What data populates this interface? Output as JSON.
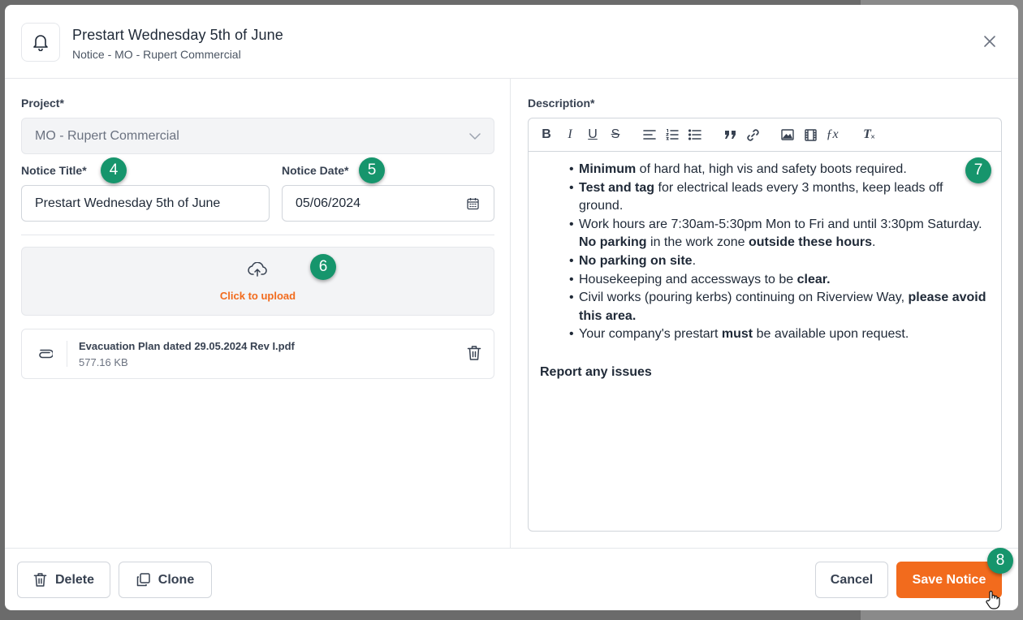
{
  "header": {
    "title": "Prestart Wednesday 5th of June",
    "subtitle": "Notice - MO - Rupert Commercial"
  },
  "form": {
    "project_label": "Project*",
    "project_value": "MO - Rupert Commercial",
    "title_label": "Notice Title*",
    "title_value": "Prestart Wednesday 5th of June",
    "date_label": "Notice Date*",
    "date_value": "05/06/2024",
    "upload_text": "Click to upload",
    "attachment": {
      "name": "Evacuation Plan dated 29.05.2024 Rev I.pdf",
      "size": "577.16 KB"
    }
  },
  "description": {
    "label": "Description*",
    "toolbar": [
      "bold",
      "italic",
      "underline",
      "strikethrough",
      "align-left",
      "ordered-list",
      "bullet-list",
      "blockquote",
      "link",
      "image",
      "video",
      "formula",
      "clear-format"
    ],
    "bullets": [
      {
        "parts": [
          {
            "b": "Minimum"
          },
          {
            "t": " of hard hat, high vis and safety boots required."
          }
        ]
      },
      {
        "parts": [
          {
            "b": "Test and tag"
          },
          {
            "t": " for electrical leads every 3 months, keep leads off ground."
          }
        ]
      },
      {
        "parts": [
          {
            "t": "Work hours are 7:30am-5:30pm Mon to Fri and until 3:30pm Saturday. "
          },
          {
            "b": "No parking"
          },
          {
            "t": " in the work zone "
          },
          {
            "b": "outside these hours"
          },
          {
            "t": "."
          }
        ]
      },
      {
        "parts": [
          {
            "b": "No parking on site"
          },
          {
            "t": "."
          }
        ]
      },
      {
        "parts": [
          {
            "t": "Housekeeping and accessways to be "
          },
          {
            "b": "clear."
          }
        ]
      },
      {
        "parts": [
          {
            "t": "Civil works (pouring kerbs) continuing on Riverview Way, "
          },
          {
            "b": "please avoid this area."
          }
        ]
      },
      {
        "parts": [
          {
            "t": "Your company's prestart "
          },
          {
            "b": "must"
          },
          {
            "t": " be available upon request."
          }
        ]
      }
    ],
    "closing": "Report any issues"
  },
  "footer": {
    "delete_label": "Delete",
    "clone_label": "Clone",
    "cancel_label": "Cancel",
    "save_label": "Save Notice"
  },
  "badges": {
    "b4": "4",
    "b5": "5",
    "b6": "6",
    "b7": "7",
    "b8": "8"
  },
  "colors": {
    "accent": "#f26b1d",
    "badge": "#16956c"
  }
}
